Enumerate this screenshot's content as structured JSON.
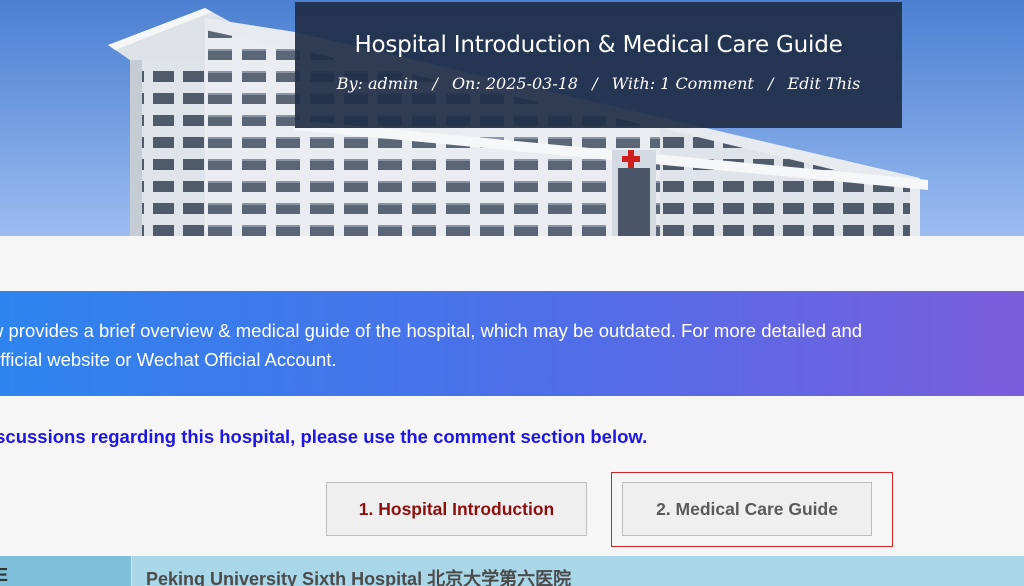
{
  "post": {
    "title": "Hospital Introduction & Medical Care Guide",
    "meta": {
      "by_label": "By:",
      "author": "admin",
      "on_label": "On:",
      "date": "2025-03-18",
      "with_label": "With:",
      "comments": "1 Comment",
      "edit": "Edit This",
      "separator": "/"
    }
  },
  "notice": {
    "line1": "w provides a brief overview & medical guide of the hospital, which may be outdated. For more detailed and",
    "line2": "official website or Wechat Official Account."
  },
  "comment_prompt": "iscussions regarding this hospital, please use the comment section below.",
  "tabs": [
    {
      "label": "1. Hospital Introduction"
    },
    {
      "label": "2. Medical Care Guide"
    }
  ],
  "info_table": {
    "row1": {
      "key": "E",
      "value": "Peking University Sixth Hospital 北京大学第六医院"
    }
  },
  "colors": {
    "title_box": "#202e48",
    "notice_start": "#2e84ee",
    "notice_end": "#7a5ddc",
    "comment_prompt": "#1f16e0",
    "tab_active_text": "#8e0d0d",
    "tab_frame": "#d02525",
    "table_key_bg": "#7fbfd9",
    "table_val_bg": "#aad7e8"
  }
}
